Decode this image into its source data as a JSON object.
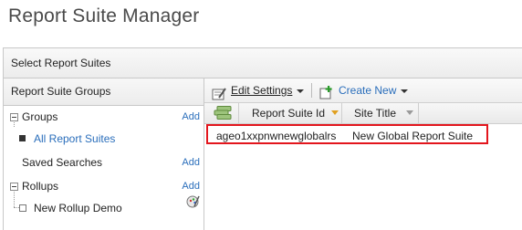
{
  "page_title": "Report Suite Manager",
  "select_header": "Select Report Suites",
  "left_panel": {
    "title": "Report Suite Groups",
    "groups": {
      "label": "Groups",
      "add": "Add",
      "item": "All Report Suites"
    },
    "saved_searches": {
      "label": "Saved Searches",
      "add": "Add"
    },
    "rollups": {
      "label": "Rollups",
      "add": "Add",
      "item": "New Rollup Demo"
    }
  },
  "toolbar": {
    "edit_settings": "Edit Settings",
    "create_new": "Create New"
  },
  "grid": {
    "columns": [
      "Report Suite Id",
      "Site Title"
    ],
    "rows": [
      {
        "id": "ageo1xxpnwnewglobalrs",
        "title": "New Global Report Suite"
      }
    ]
  },
  "colors": {
    "link": "#2a6ebb",
    "highlight_border": "#e3161d"
  }
}
